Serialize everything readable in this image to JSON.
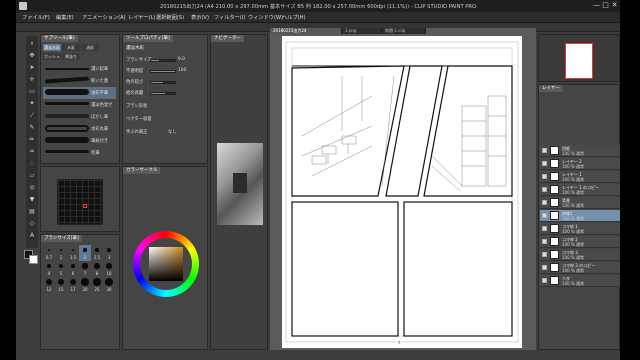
{
  "window": {
    "title": "20180215出力24 (A4 210.00 x 297.00mm 基本サイズ B5 判 182.00 x 257.00mm 600dpi (11.1%)) - CLIP STUDIO PAINT PRO",
    "icons": {
      "app": "clip-studio-icon",
      "minimize": "minimize-icon",
      "maximize": "maximize-icon",
      "close": "close-icon"
    },
    "win_minimize": "—",
    "win_maximize": "□",
    "win_close": "✕"
  },
  "menubar": [
    "ファイル(F)",
    "編集(E)",
    "アニメーション(A)",
    "レイヤー(L)",
    "選択範囲(S)",
    "表示(V)",
    "フィルター(I)",
    "ウィンドウ(W)",
    "ヘルプ(H)"
  ],
  "brush_panel": {
    "tabs": [
      "サブツール[筆]",
      "ツールプロパティ[筆]"
    ],
    "subtabs": [
      "濃淡水彩",
      "水彩",
      "油彩",
      "ガッシュ",
      "厚塗り"
    ],
    "brushes": [
      {
        "label": "濃い鉛筆"
      },
      {
        "label": "乾いた墨"
      },
      {
        "label": "油彩平筆"
      },
      {
        "label": "濃淡色混ぜ"
      },
      {
        "label": "ぼかし筆"
      },
      {
        "label": "水彩丸筆"
      },
      {
        "label": "筆痕付き"
      },
      {
        "label": "毛筆"
      }
    ]
  },
  "tool_property": {
    "title": "濃淡水彩",
    "rows": [
      {
        "label": "ブラシサイズ",
        "value": "9.0",
        "level": 0.35
      },
      {
        "label": "不透明度",
        "value": "100",
        "level": 1.0
      },
      {
        "label": "色の延び",
        "value": "",
        "level": 0.5
      },
      {
        "label": "絵の具量",
        "value": "",
        "level": 0.6
      },
      {
        "label": "ブラシ形状",
        "value": "",
        "level": 0.0
      },
      {
        "label": "ベクター吸着",
        "value": "",
        "level": 0.0
      },
      {
        "label": "手ぶれ補正",
        "value": "なし",
        "level": 0.0
      }
    ]
  },
  "color_panel": {
    "tabs": [
      "カラーサークル"
    ],
    "main_color": "#111111",
    "sub_color": "#ffffff"
  },
  "brush_size_panel": {
    "tab": "ブラシサイズ[筆]",
    "sizes": [
      "0.7",
      "1",
      "1.5",
      "2",
      "2.5",
      "3",
      "4",
      "5",
      "6",
      "7",
      "8",
      "10",
      "12",
      "15",
      "17",
      "20",
      "25",
      "30"
    ]
  },
  "navigator": {
    "tab": "ナビゲーター"
  },
  "canvas": {
    "tabs": [
      {
        "label": "20180215出力24"
      },
      {
        "label": "3.png"
      },
      {
        "label": "無題-1.clip"
      }
    ],
    "page_number": "4"
  },
  "layers": {
    "tabs": [
      "レイヤー"
    ],
    "rows": [
      {
        "name": "用紙",
        "mode": "100 % 通常"
      },
      {
        "name": "レイヤー 2",
        "mode": "100 % 通常"
      },
      {
        "name": "レイヤー 1",
        "mode": "100 % 通常"
      },
      {
        "name": "レイヤー 1 のコピー",
        "mode": "100 % 通常"
      },
      {
        "name": "背景",
        "mode": "100 % 通常"
      },
      {
        "name": "枠線1",
        "mode": "100 % 通常"
      },
      {
        "name": "コマ枠 1",
        "mode": "100 % 通常"
      },
      {
        "name": "コマ枠 2",
        "mode": "100 % 通常"
      },
      {
        "name": "コマ枠 3",
        "mode": "100 % 通常"
      },
      {
        "name": "コマ枠 3 のコピー",
        "mode": "100 % 通常"
      },
      {
        "name": "ベタ",
        "mode": "100 % 通常"
      }
    ],
    "selected_index": 5
  },
  "colors": {
    "accent": "#7490ab",
    "panel": "#454545",
    "dark": "#2a2a2a"
  }
}
